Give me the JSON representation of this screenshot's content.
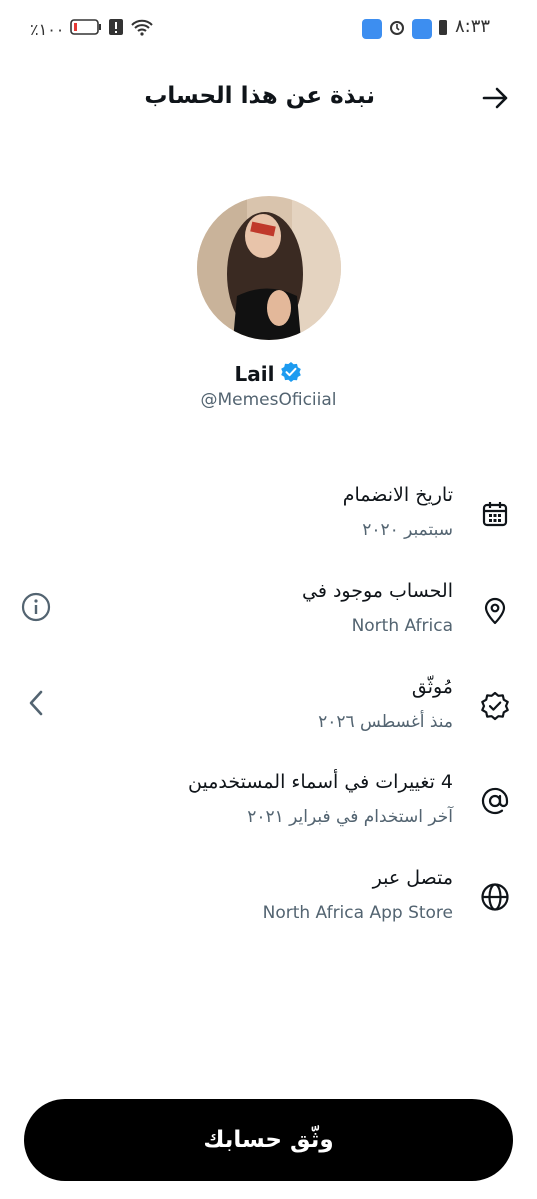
{
  "status_bar": {
    "time": "٨:٣٣",
    "battery_percent": "٪١٠٠"
  },
  "header": {
    "title": "نبذة عن هذا الحساب",
    "back_icon": "arrow-right-icon"
  },
  "profile": {
    "display_name": "Lail",
    "handle": "@MemesOficiial",
    "verified": true,
    "verified_color": "#1d9bf0"
  },
  "rows": [
    {
      "icon": "calendar-icon",
      "title": "تاريخ الانضمام",
      "subtitle": "سبتمبر ٢٠٢٠"
    },
    {
      "icon": "location-pin-icon",
      "title": "الحساب موجود في",
      "subtitle": "North Africa",
      "side_icon": "info-icon"
    },
    {
      "icon": "verified-badge-icon",
      "title": "مُوثّق",
      "subtitle": "منذ أغسطس ٢٠٢٦",
      "side_icon": "chevron-left-icon"
    },
    {
      "icon": "at-sign-icon",
      "title": "4 تغييرات في أسماء المستخدمين",
      "subtitle": "آخر استخدام في فبراير ٢٠٢١"
    },
    {
      "icon": "globe-icon",
      "title": "متصل عبر",
      "subtitle": "North Africa App Store"
    }
  ],
  "verify_button": {
    "label": "وثّق حسابك"
  },
  "colors": {
    "text_primary": "#0f1419",
    "text_secondary": "#536471",
    "button_bg": "#000000"
  }
}
